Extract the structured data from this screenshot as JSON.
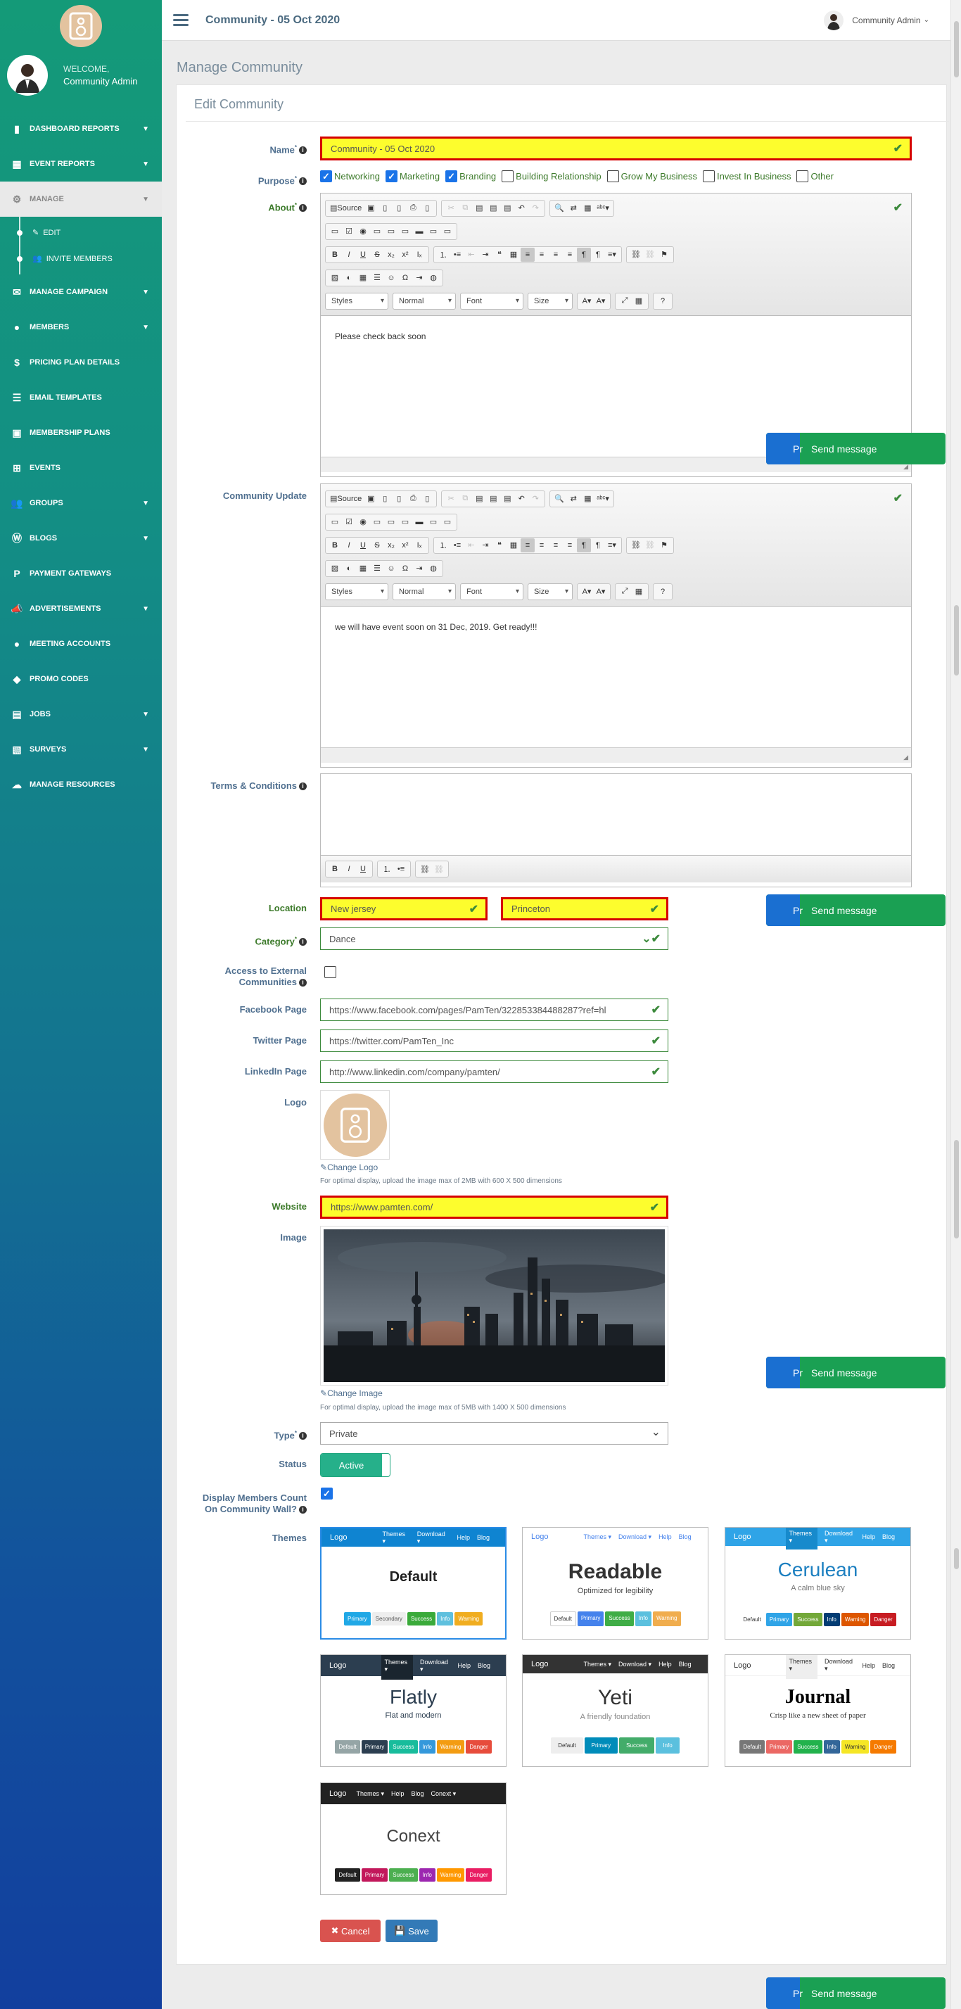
{
  "topbar": {
    "title": "Community - 05 Oct 2020",
    "user": "Community Admin"
  },
  "sidebar": {
    "welcome": "WELCOME,",
    "username": "Community Admin",
    "items": [
      {
        "label": "DASHBOARD REPORTS",
        "icon": "bar-chart-icon"
      },
      {
        "label": "EVENT REPORTS",
        "icon": "table-icon"
      },
      {
        "label": "MANAGE",
        "icon": "gear-icon"
      },
      {
        "label": "MANAGE CAMPAIGN",
        "icon": "envelope-icon"
      },
      {
        "label": "MEMBERS",
        "icon": "user-icon"
      },
      {
        "label": "PRICING PLAN DETAILS",
        "icon": "dollar-icon"
      },
      {
        "label": "EMAIL TEMPLATES",
        "icon": "list-icon"
      },
      {
        "label": "MEMBERSHIP PLANS",
        "icon": "id-card-icon"
      },
      {
        "label": "EVENTS",
        "icon": "grid-icon"
      },
      {
        "label": "GROUPS",
        "icon": "users-icon"
      },
      {
        "label": "BLOGS",
        "icon": "wordpress-icon"
      },
      {
        "label": "PAYMENT GATEWAYS",
        "icon": "paypal-icon"
      },
      {
        "label": "ADVERTISEMENTS",
        "icon": "bullhorn-icon"
      },
      {
        "label": "MEETING ACCOUNTS",
        "icon": "user-tie-icon"
      },
      {
        "label": "PROMO CODES",
        "icon": "tag-icon"
      },
      {
        "label": "JOBS",
        "icon": "briefcase-icon"
      },
      {
        "label": "SURVEYS",
        "icon": "clipboard-icon"
      },
      {
        "label": "MANAGE RESOURCES",
        "icon": "cloud-upload-icon"
      }
    ],
    "sub_items": [
      {
        "label": "EDIT",
        "icon": "edit-icon"
      },
      {
        "label": "INVITE MEMBERS",
        "icon": "users-icon"
      }
    ]
  },
  "page": {
    "heading": "Manage Community",
    "panel_title": "Edit Community"
  },
  "labels": {
    "name": "Name",
    "purpose": "Purpose",
    "about": "About",
    "community_update": "Community Update",
    "terms": "Terms & Conditions",
    "location": "Location",
    "category": "Category",
    "access_external_1": "Access to External",
    "access_external_2": "Communities",
    "facebook": "Facebook Page",
    "twitter": "Twitter Page",
    "linkedin": "LinkedIn Page",
    "logo": "Logo",
    "website": "Website",
    "image": "Image",
    "type": "Type",
    "status": "Status",
    "display_count_1": "Display Members Count",
    "display_count_2": "On Community Wall?",
    "themes": "Themes"
  },
  "form": {
    "name": "Community - 05 Oct 2020",
    "purpose_options": [
      {
        "label": "Networking",
        "checked": true
      },
      {
        "label": "Marketing",
        "checked": true
      },
      {
        "label": "Branding",
        "checked": true
      },
      {
        "label": "Building Relationship",
        "checked": false
      },
      {
        "label": "Grow My Business",
        "checked": false
      },
      {
        "label": "Invest In Business",
        "checked": false
      },
      {
        "label": "Other",
        "checked": false
      }
    ],
    "about_text": "Please check back soon",
    "update_text": "we will have event soon on 31 Dec, 2019. Get ready!!!",
    "location_1": "New jersey",
    "location_2": "Princeton",
    "category": "Dance",
    "facebook": "https://www.facebook.com/pages/PamTen/322853384488287?ref=hl",
    "twitter": "https://twitter.com/PamTen_Inc",
    "linkedin": "http://www.linkedin.com/company/pamten/",
    "change_logo": "Change Logo",
    "logo_help": "For optimal display, upload the image max of 2MB with 600 X 500 dimensions",
    "website": "https://www.pamten.com/",
    "change_image": "Change Image",
    "image_help": "For optimal display, upload the image max of 5MB with 1400 X 500 dimensions",
    "type": "Private",
    "status": "Active",
    "display_count": true
  },
  "editor": {
    "source": "Source",
    "styles": "Styles",
    "format": "Normal",
    "font": "Font",
    "size": "Size"
  },
  "themes": [
    {
      "name": "Default",
      "sub": "",
      "selected": true
    },
    {
      "name": "Readable",
      "sub": "Optimized for legibility",
      "selected": false
    },
    {
      "name": "Cerulean",
      "sub": "A calm blue sky",
      "selected": false
    },
    {
      "name": "Flatly",
      "sub": "Flat and modern",
      "selected": false
    },
    {
      "name": "Yeti",
      "sub": "A friendly foundation",
      "selected": false
    },
    {
      "name": "Journal",
      "sub": "Crisp like a new sheet of paper",
      "selected": false
    },
    {
      "name": "Conext",
      "sub": "",
      "selected": false
    }
  ],
  "theme_preview": {
    "logo": "Logo",
    "nav_themes": "Themes ▾",
    "nav_download": "Download ▾",
    "nav_help": "Help",
    "nav_blog": "Blog",
    "nav_conext": "Conext ▾",
    "btn_default": "Default",
    "btn_primary": "Primary",
    "btn_secondary": "Secondary",
    "btn_success": "Success",
    "btn_info": "Info",
    "btn_warning": "Warning",
    "btn_danger": "Danger"
  },
  "actions": {
    "cancel": "Cancel",
    "save": "Save"
  },
  "chat": {
    "label": "Send message",
    "partial": "Pr"
  },
  "colors": {
    "accent_green": "#149a78",
    "highlight_yellow": "#fdfd2d",
    "error_red": "#d50000"
  }
}
